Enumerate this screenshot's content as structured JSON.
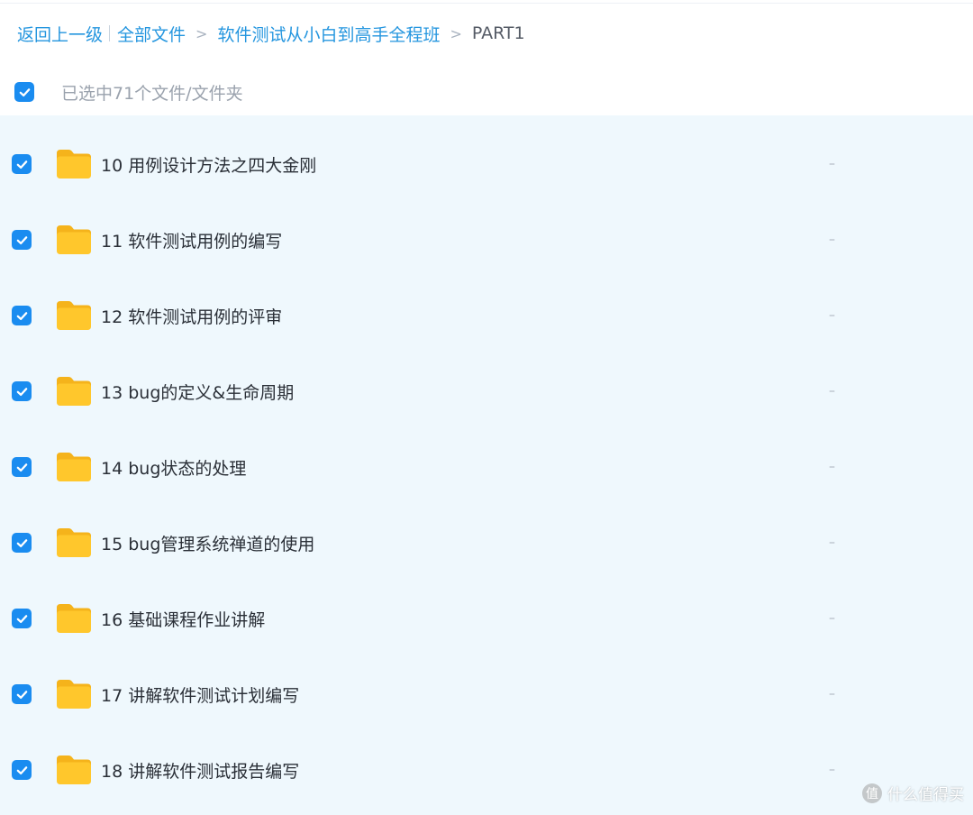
{
  "breadcrumb": {
    "back_label": "返回上一级",
    "all_files_label": "全部文件",
    "course_label": "软件测试从小白到高手全程班",
    "current_label": "PART1",
    "separator": ">"
  },
  "selection": {
    "summary_text": "已选中71个文件/文件夹",
    "checked": true
  },
  "colors": {
    "accent": "#1a8cf0",
    "link": "#2596df",
    "list_background": "#eff8fd",
    "folder_yellow": "#ffc72c"
  },
  "files": [
    {
      "name": "10 用例设计方法之四大金刚",
      "size": "–",
      "icon": "folder-icon",
      "checked": true
    },
    {
      "name": "11 软件测试用例的编写",
      "size": "–",
      "icon": "folder-icon",
      "checked": true
    },
    {
      "name": "12 软件测试用例的评审",
      "size": "–",
      "icon": "folder-icon",
      "checked": true
    },
    {
      "name": "13 bug的定义&生命周期",
      "size": "–",
      "icon": "folder-icon",
      "checked": true
    },
    {
      "name": "14 bug状态的处理",
      "size": "–",
      "icon": "folder-icon",
      "checked": true
    },
    {
      "name": "15 bug管理系统禅道的使用",
      "size": "–",
      "icon": "folder-icon",
      "checked": true
    },
    {
      "name": "16 基础课程作业讲解",
      "size": "–",
      "icon": "folder-icon",
      "checked": true
    },
    {
      "name": "17 讲解软件测试计划编写",
      "size": "–",
      "icon": "folder-icon",
      "checked": true
    },
    {
      "name": "18 讲解软件测试报告编写",
      "size": "–",
      "icon": "folder-icon",
      "checked": true
    }
  ],
  "watermark": {
    "logo_char": "值",
    "text": "什么值得买"
  }
}
